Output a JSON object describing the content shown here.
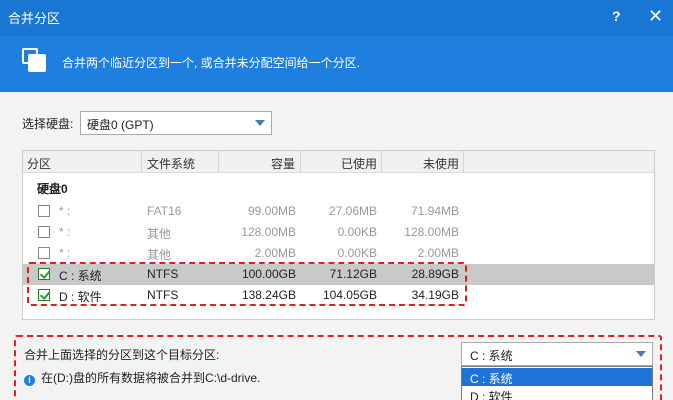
{
  "window": {
    "title": "合并分区",
    "help": "?",
    "close": "✕"
  },
  "banner": {
    "description": "合并两个临近分区到一个, 或合并未分配空间给一个分区."
  },
  "disk_select": {
    "label": "选择硬盘:",
    "value": "硬盘0 (GPT)"
  },
  "table": {
    "headers": [
      "分区",
      "文件系统",
      "容量",
      "已使用",
      "未使用"
    ],
    "group": "硬盘0",
    "rows": [
      {
        "checked": false,
        "name": "* :",
        "fs": "FAT16",
        "capacity": "99.00MB",
        "used": "27.06MB",
        "free": "71.94MB"
      },
      {
        "checked": false,
        "name": "* :",
        "fs": "其他",
        "capacity": "128.00MB",
        "used": "0.00KB",
        "free": "128.00MB"
      },
      {
        "checked": false,
        "name": "* :",
        "fs": "其他",
        "capacity": "2.00MB",
        "used": "0.00KB",
        "free": "2.00MB"
      },
      {
        "checked": true,
        "name": "C : 系统",
        "fs": "NTFS",
        "capacity": "100.00GB",
        "used": "71.12GB",
        "free": "28.89GB"
      },
      {
        "checked": true,
        "name": "D : 软件",
        "fs": "NTFS",
        "capacity": "138.24GB",
        "used": "104.05GB",
        "free": "34.19GB"
      }
    ]
  },
  "merge": {
    "label": "合并上面选择的分区到这个目标分区:",
    "target": "C : 系统",
    "options": [
      "C : 系统",
      "D : 软件"
    ],
    "info": "在(D:)盘的所有数据将被合并到C:\\d-drive."
  },
  "colors": {
    "accent": "#1e7fde",
    "titlebar": "#1976d2",
    "highlight": "#e02020"
  }
}
